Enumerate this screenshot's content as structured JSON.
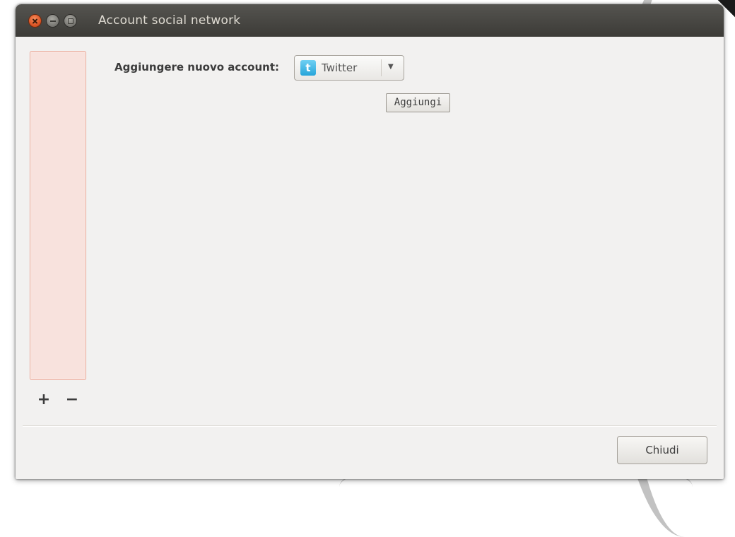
{
  "window": {
    "title": "Account social network"
  },
  "list": {
    "add_symbol": "+",
    "remove_symbol": "−"
  },
  "form": {
    "add_label": "Aggiungere nuovo account:",
    "service_selected": "Twitter",
    "service_icon_glyph": "t",
    "add_button_label": "Aggiungi"
  },
  "footer": {
    "close_button_label": "Chiudi"
  },
  "icons": {
    "close": "close-icon",
    "minimize": "minimize-icon",
    "maximize": "maximize-icon",
    "service": "twitter-icon",
    "dropdown": "chevron-down-icon"
  },
  "colors": {
    "titlebar": "#3c3b37",
    "window_bg": "#f2f1f0",
    "close_button": "#e05a2a",
    "list_bg": "#f8e2dd",
    "list_border": "#e8a494",
    "twitter_blue": "#27a5da"
  }
}
